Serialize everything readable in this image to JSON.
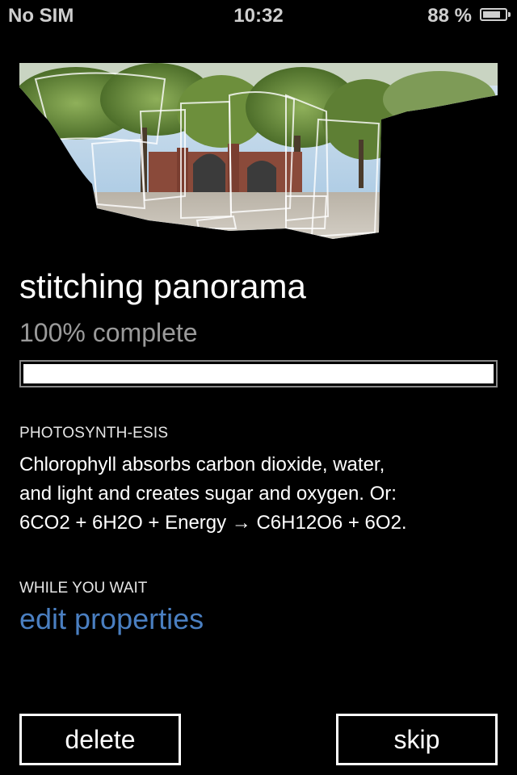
{
  "status_bar": {
    "carrier": "No SIM",
    "time": "10:32",
    "battery_text": "88 %",
    "battery_level": 0.88,
    "battery_icon": "battery-icon"
  },
  "main": {
    "title": "stitching panorama",
    "progress_text": "100% complete",
    "progress_value": 1.0,
    "tip": {
      "heading": "PHOTOSYNTH-ESIS",
      "body_line1": "Chlorophyll absorbs carbon dioxide, water,",
      "body_line2": "and light and creates sugar and oxygen. Or:",
      "body_line3": "6CO2 + 6H2O + Energy →  C6H12O6 + 6O2."
    },
    "wait": {
      "heading": "WHILE YOU WAIT",
      "link": "edit properties",
      "link_color": "#4a7fc1"
    }
  },
  "buttons": {
    "delete": "delete",
    "skip": "skip"
  }
}
